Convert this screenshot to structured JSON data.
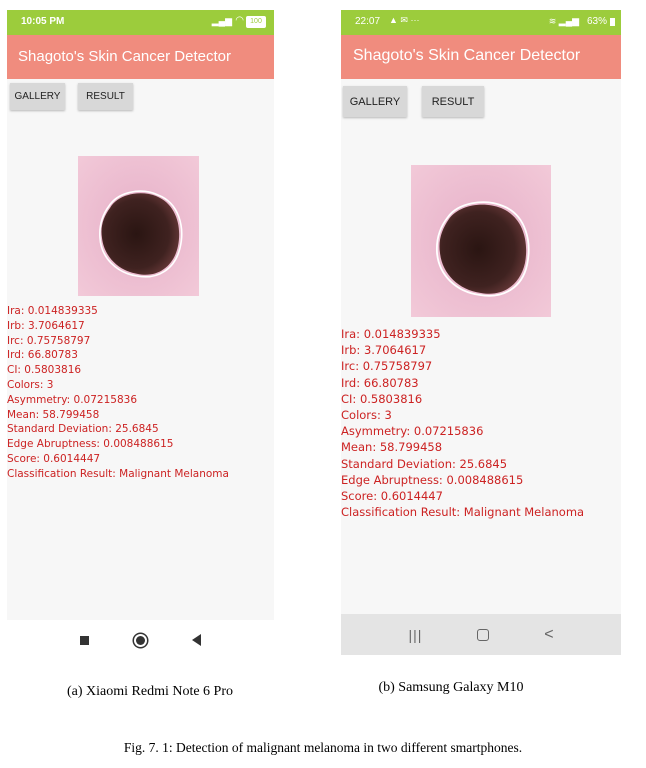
{
  "phone_a": {
    "status_time": "10:05 PM",
    "status_battery": "100",
    "app_title": "Shagoto's Skin Cancer  Detector",
    "gallery_label": "GALLERY",
    "result_label": "RESULT",
    "results": [
      "Ira: 0.014839335",
      "Irb: 3.7064617",
      "Irc: 0.75758797",
      "Ird: 66.80783",
      "CI: 0.5803816",
      "Colors: 3",
      "Asymmetry: 0.07215836",
      "Mean: 58.799458",
      "Standard Deviation: 25.6845",
      "Edge Abruptness: 0.008488615",
      "Score: 0.6014447",
      "Classification Result: Malignant Melanoma"
    ],
    "nav_icons": [
      "square-icon",
      "circle-icon",
      "triangle-back-icon"
    ]
  },
  "phone_b": {
    "status_time": "22:07",
    "status_battery": "63%",
    "app_title": "Shagoto's Skin Cancer  Detector",
    "gallery_label": "GALLERY",
    "result_label": "RESULT",
    "results": [
      "Ira: 0.014839335",
      "Irb: 3.7064617",
      "Irc: 0.75758797",
      "Ird: 66.80783",
      "CI: 0.5803816",
      "Colors: 3",
      "Asymmetry: 0.07215836",
      "Mean: 58.799458",
      "Standard Deviation: 25.6845",
      "Edge Abruptness: 0.008488615",
      "Score: 0.6014447",
      "Classification Result: Malignant Melanoma"
    ],
    "nav_icons": [
      "recents-icon",
      "home-icon",
      "back-chevron-icon"
    ]
  },
  "captions": {
    "a": "(a)  Xiaomi Redmi Note 6 Pro",
    "b": "(b) Samsung Galaxy M10",
    "figure": "Fig. 7. 1: Detection of malignant melanoma in two different smartphones."
  },
  "colors": {
    "status_green": "#9ccc3c",
    "appbar_salmon": "#f08c7e",
    "result_text": "#cc2222",
    "screen_bg": "#f7f7f7",
    "navbar_gray": "#e4e4e4"
  }
}
